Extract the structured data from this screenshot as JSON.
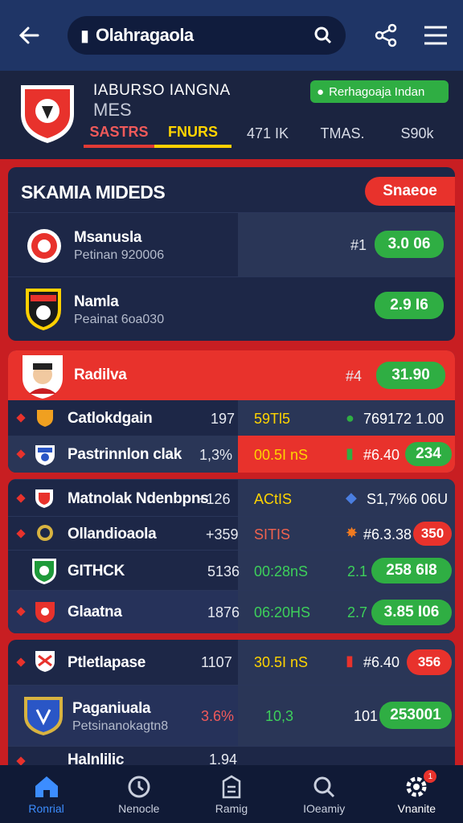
{
  "topbar": {
    "search_value": "Olahragaola"
  },
  "team": {
    "name": "IABURSO IANGNA",
    "sub": "MES",
    "follow_label": "Rerhagoaja Indan",
    "tabs": [
      "SASTRS",
      "FNURS",
      "471 IK",
      "TMAS.",
      "S90k"
    ]
  },
  "section1": {
    "title": "SKAMIA MIDEDS",
    "action_label": "Snaeoe",
    "rows": [
      {
        "name": "Msanusla",
        "sub": "Petinan 920006",
        "rank": "#1",
        "value": "3.0 06"
      },
      {
        "name": "Namla",
        "sub": "Peainat 6oa030",
        "value": "2.9 I6"
      }
    ]
  },
  "section2": {
    "header": {
      "name": "Radilva",
      "rank": "#4",
      "value": "31.90"
    },
    "rows": [
      {
        "name": "Catlokdgain",
        "num": "197",
        "time": "59Tl5",
        "odds": "769172 1.00"
      },
      {
        "name": "Pastrinnlon clak",
        "num": "1,3%",
        "time": "00.5I nS",
        "odds": "#6.40",
        "value": "234"
      }
    ]
  },
  "section3": {
    "rows": [
      {
        "name": "Matnolak Ndenbpns",
        "num": "+126",
        "time": "ACtIS",
        "odds": "S1,7%6 06U"
      },
      {
        "name": "Ollandioaola",
        "num": "+359",
        "time": "SITIS",
        "odds": "#6.3.38",
        "value": "350"
      },
      {
        "name": "GITHCK",
        "num": "5136",
        "time": "00:28nS",
        "odds": "2.1",
        "value": "258 6I8"
      },
      {
        "name": "Glaatna",
        "num": "1876",
        "time": "06:20HS",
        "odds": "2.7",
        "value": "3.85 I06"
      }
    ]
  },
  "section4": {
    "rows": [
      {
        "name": "Ptletlapase",
        "num": "1107",
        "time": "30.5I nS",
        "odds": "#6.40",
        "value": "356"
      },
      {
        "name": "Paganiuala",
        "sub": "Petsinanokagtn8",
        "num": "3.6%",
        "time": "10,3",
        "odds": "101",
        "value": "253001"
      },
      {
        "name": "Halnlilic",
        "num": "1.94"
      }
    ]
  },
  "nav": [
    {
      "label": "Ronrial",
      "icon": "home-icon"
    },
    {
      "label": "Nenocle",
      "icon": "clock-icon"
    },
    {
      "label": "Ramig",
      "icon": "document-icon"
    },
    {
      "label": "IOeamiy",
      "icon": "search-icon"
    },
    {
      "label": "Vnanite",
      "icon": "settings-icon",
      "badge": "1"
    }
  ],
  "colors": {
    "accent_red": "#e8322c",
    "accent_green": "#2fae43",
    "accent_yellow": "#ffd400",
    "navy": "#1d2747"
  }
}
